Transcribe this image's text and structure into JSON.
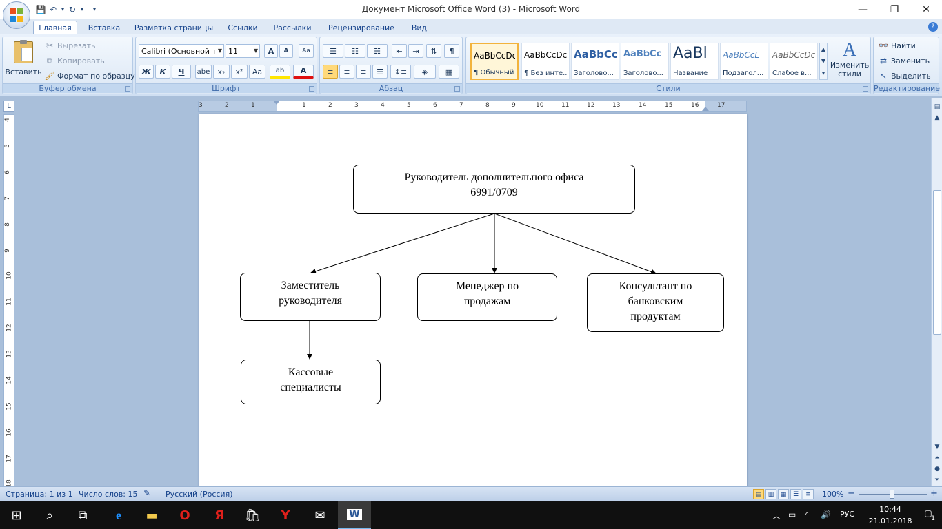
{
  "window": {
    "title": "Документ Microsoft Office Word (3) - Microsoft Word",
    "minimize": "—",
    "restore": "❐",
    "close": "✕"
  },
  "qat": {
    "save": "💾",
    "undo": "↶",
    "redo": "↻",
    "more": "▾"
  },
  "tabs": [
    {
      "label": "Главная",
      "active": true
    },
    {
      "label": "Вставка"
    },
    {
      "label": "Разметка страницы"
    },
    {
      "label": "Ссылки"
    },
    {
      "label": "Рассылки"
    },
    {
      "label": "Рецензирование"
    },
    {
      "label": "Вид"
    }
  ],
  "ribbon": {
    "clipboard": {
      "label": "Буфер обмена",
      "paste": "Вставить",
      "cut": "Вырезать",
      "copy": "Копировать",
      "format_painter": "Формат по образцу"
    },
    "font": {
      "label": "Шрифт",
      "font_name": "Calibri (Основной те",
      "font_size": "11",
      "grow": "A",
      "shrink": "A",
      "clear": "Aa",
      "bold": "Ж",
      "italic": "К",
      "underline": "Ч",
      "strike": "abe",
      "subscript": "x₂",
      "superscript": "x²",
      "case": "Aa",
      "highlight": "ab",
      "color": "A"
    },
    "paragraph": {
      "label": "Абзац",
      "pilcrow": "¶"
    },
    "styles": {
      "label": "Стили",
      "items": [
        {
          "sample": "AaBbCcDc",
          "name": "¶ Обычный",
          "active": true
        },
        {
          "sample": "AaBbCcDc",
          "name": "¶ Без инте..."
        },
        {
          "sample": "AaBbCc",
          "name": "Заголово..."
        },
        {
          "sample": "AaBbCc",
          "name": "Заголово..."
        },
        {
          "sample": "AaBl",
          "name": "Название"
        },
        {
          "sample": "AaBbCcL",
          "name": "Подзагол..."
        },
        {
          "sample": "AaBbCcDc",
          "name": "Слабое в..."
        }
      ],
      "change_styles_line1": "Изменить",
      "change_styles_line2": "стили"
    },
    "editing": {
      "label": "Редактирование",
      "find": "Найти",
      "replace": "Заменить",
      "select": "Выделить"
    }
  },
  "ruler": {
    "hticks": [
      "3",
      "2",
      "1",
      "1",
      "2",
      "3",
      "4",
      "5",
      "6",
      "7",
      "8",
      "9",
      "10",
      "11",
      "12",
      "13",
      "14",
      "15",
      "16",
      "17"
    ],
    "vticks": [
      "4",
      "5",
      "6",
      "7",
      "8",
      "9",
      "10",
      "11",
      "12",
      "13",
      "14",
      "15",
      "16",
      "17",
      "18"
    ]
  },
  "orgchart": {
    "root": "Руководитель дополнительного офиса 6991/0709",
    "deputy": "Заместитель руководителя",
    "sales_manager": "Менеджер по продажам",
    "consultant": "Консультант по банковским продуктам",
    "cashiers": "Кассовые специалисты"
  },
  "status": {
    "page": "Страница: 1 из 1",
    "words": "Число слов: 15",
    "language": "Русский (Россия)",
    "zoom": "100%",
    "zoom_minus": "−",
    "zoom_plus": "+"
  },
  "taskbar": {
    "lang": "РУС",
    "time": "10:44",
    "date": "21.01.2018",
    "notifications": "1"
  }
}
